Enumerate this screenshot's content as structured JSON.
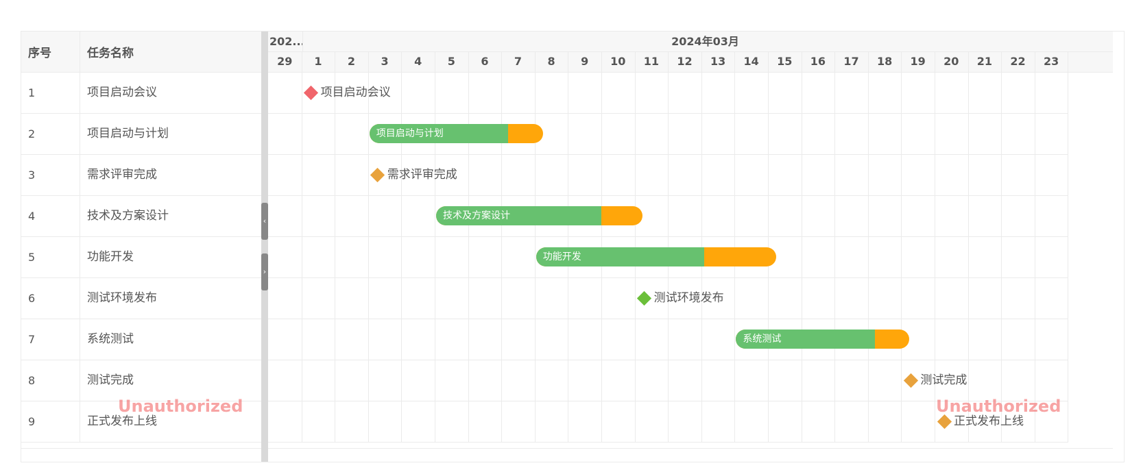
{
  "table": {
    "headers": {
      "index": "序号",
      "name": "任务名称"
    },
    "rows": [
      {
        "index": "1",
        "name": "项目启动会议"
      },
      {
        "index": "2",
        "name": "项目启动与计划"
      },
      {
        "index": "3",
        "name": "需求评审完成"
      },
      {
        "index": "4",
        "name": "技术及方案设计"
      },
      {
        "index": "5",
        "name": "功能开发"
      },
      {
        "index": "6",
        "name": "测试环境发布"
      },
      {
        "index": "7",
        "name": "系统测试"
      },
      {
        "index": "8",
        "name": "测试完成"
      },
      {
        "index": "9",
        "name": "正式发布上线"
      }
    ]
  },
  "timeline": {
    "prev_month_label": "202...",
    "month_label": "2024年03月",
    "days": [
      "29",
      "1",
      "2",
      "3",
      "4",
      "5",
      "6",
      "7",
      "8",
      "9",
      "10",
      "11",
      "12",
      "13",
      "14",
      "15",
      "16",
      "17",
      "18",
      "19",
      "20",
      "21",
      "22",
      "23"
    ]
  },
  "tasks": [
    {
      "type": "milestone",
      "label": "项目启动会议",
      "date": "2024-03-01",
      "color": "#f0656b"
    },
    {
      "type": "bar",
      "label": "项目启动与计划",
      "start": "2024-03-03",
      "end": "2024-03-08",
      "progress": 0.8
    },
    {
      "type": "milestone",
      "label": "需求评审完成",
      "date": "2024-03-03",
      "color": "#e8a23c"
    },
    {
      "type": "bar",
      "label": "技术及方案设计",
      "start": "2024-03-05",
      "end": "2024-03-11",
      "progress": 0.8
    },
    {
      "type": "bar",
      "label": "功能开发",
      "start": "2024-03-08",
      "end": "2024-03-15",
      "progress": 0.7
    },
    {
      "type": "milestone",
      "label": "测试环境发布",
      "date": "2024-03-11",
      "color": "#6bbf3a"
    },
    {
      "type": "bar",
      "label": "系统测试",
      "start": "2024-03-14",
      "end": "2024-03-19",
      "progress": 0.8
    },
    {
      "type": "milestone",
      "label": "测试完成",
      "date": "2024-03-19",
      "color": "#e8a23c"
    },
    {
      "type": "milestone",
      "label": "正式发布上线",
      "date": "2024-03-20",
      "color": "#e8a23c"
    }
  ],
  "colors": {
    "bar_progress": "#67c16f",
    "bar_remaining": "#ffa60a"
  },
  "collapse_buttons": {
    "left": "‹",
    "right": "›"
  },
  "watermarks": [
    "Unauthorized",
    "Unauthorized"
  ]
}
